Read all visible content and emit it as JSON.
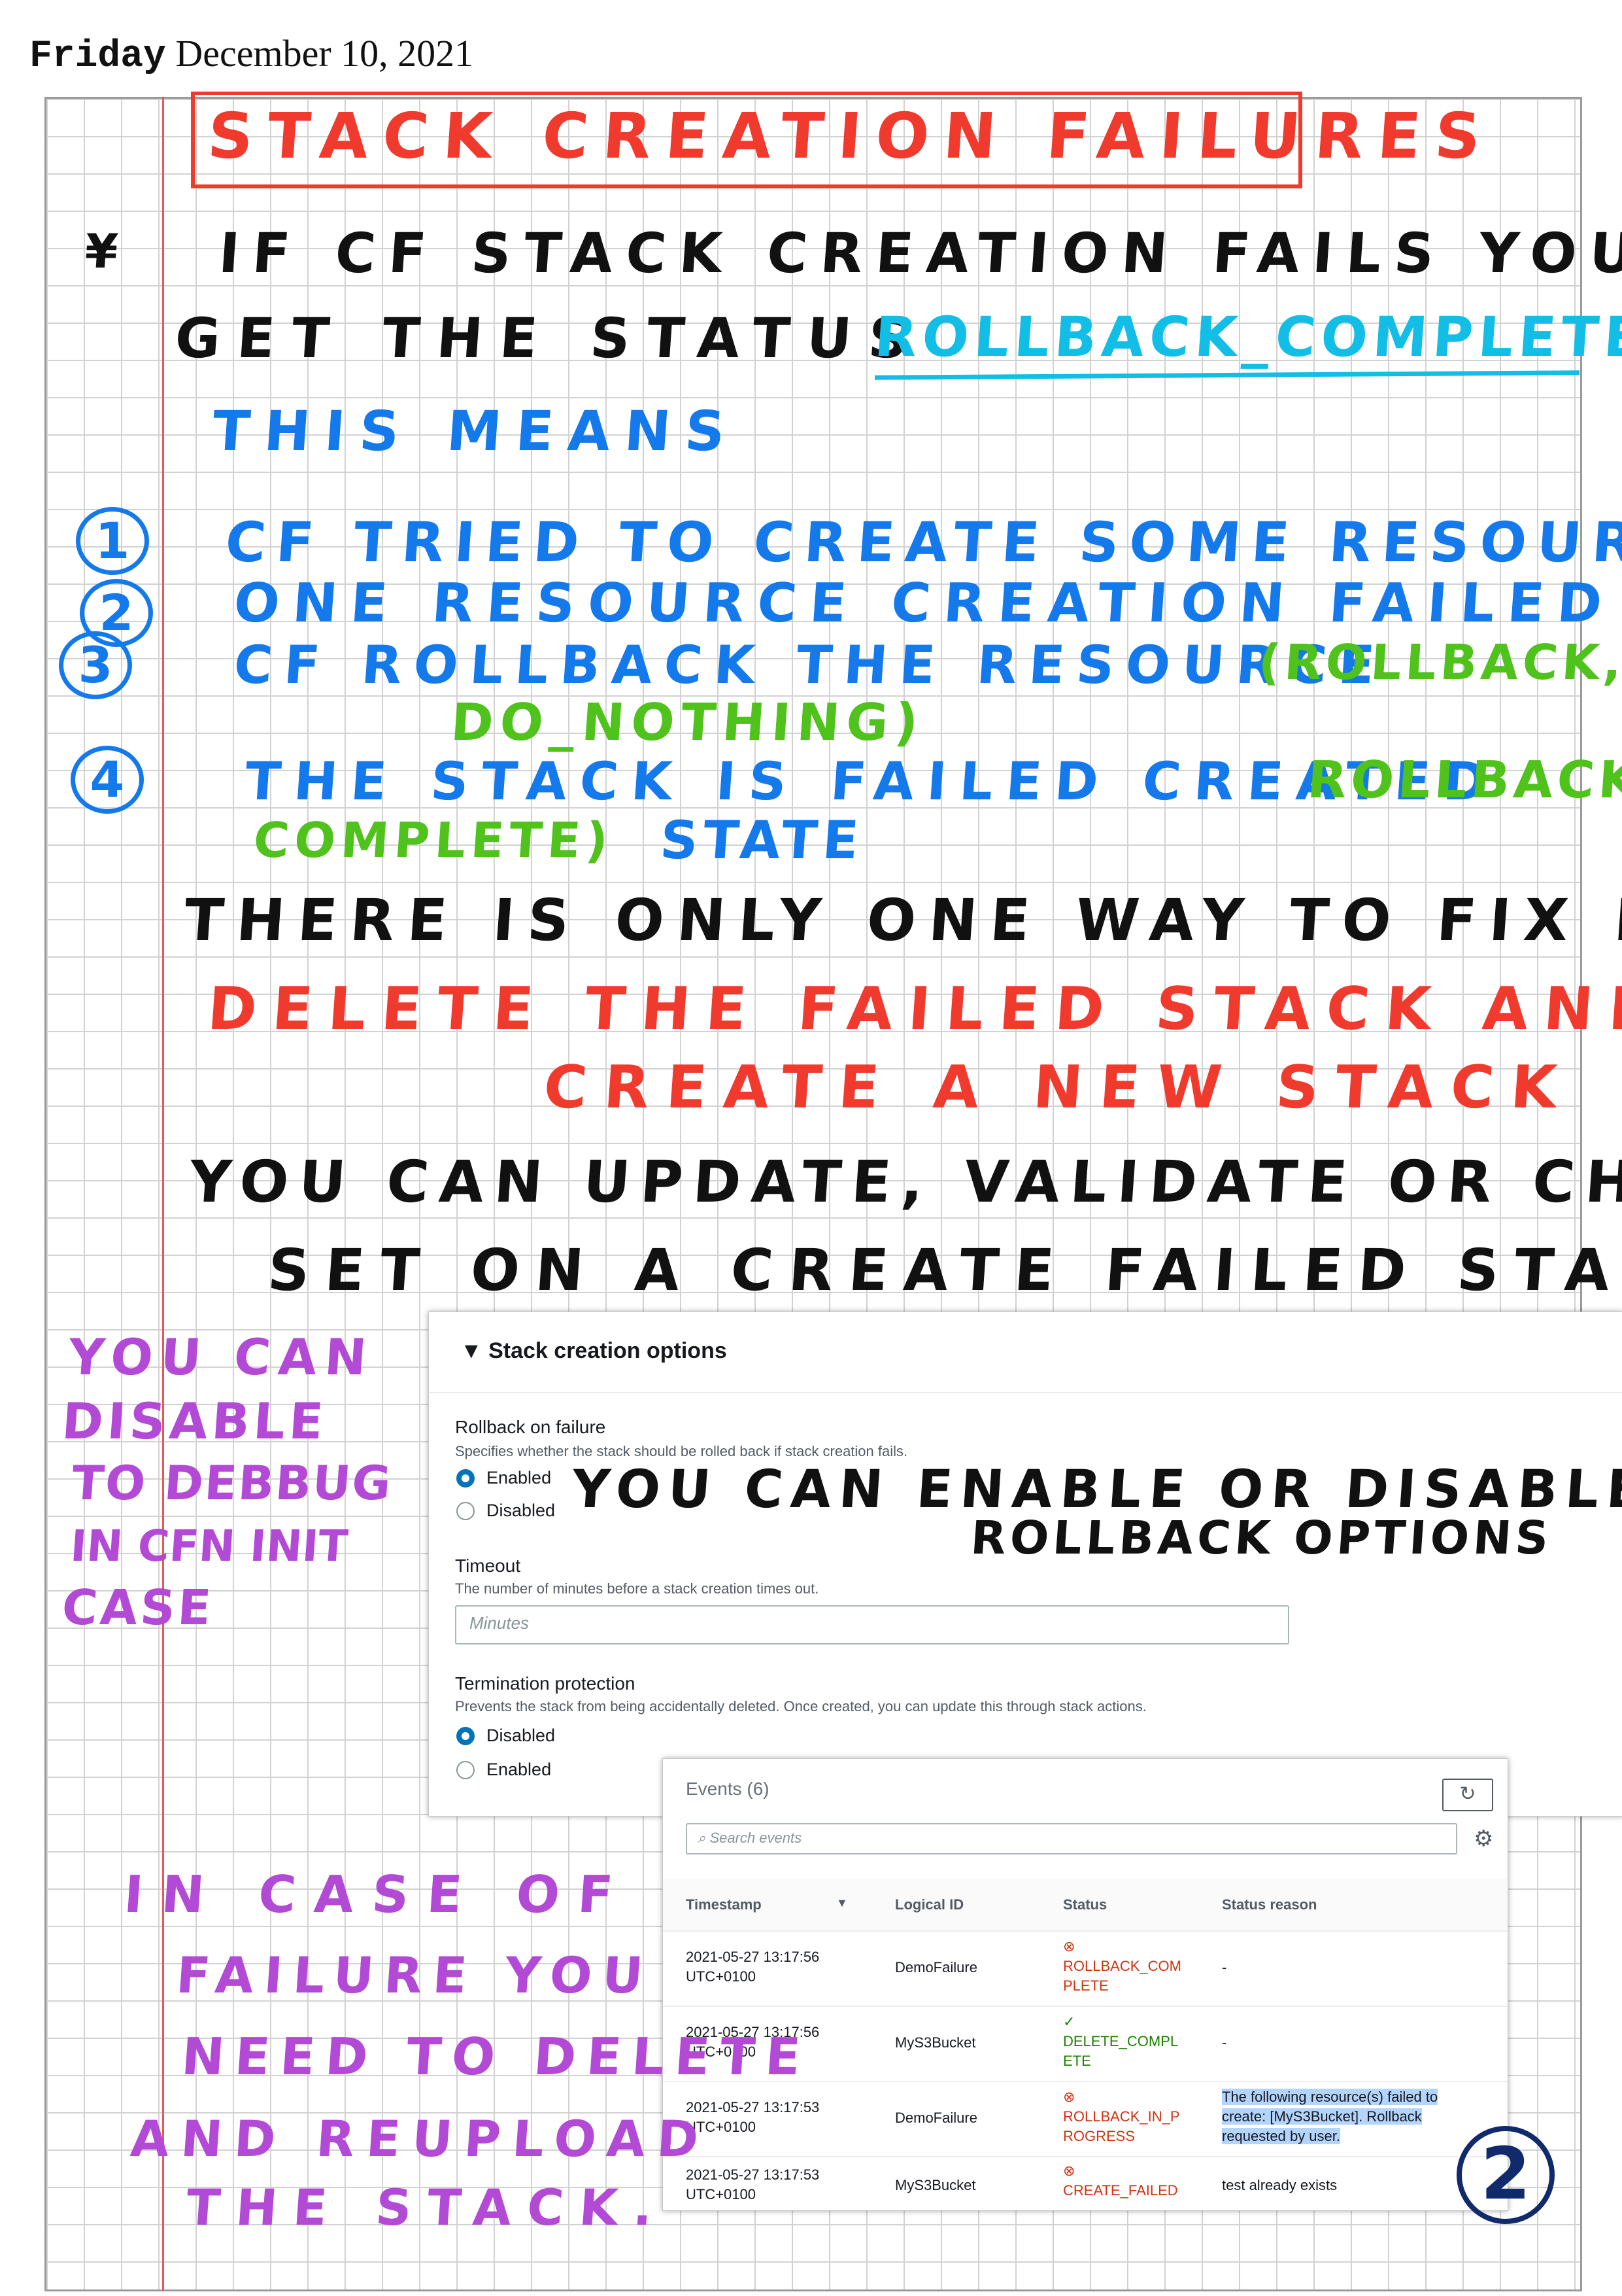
{
  "date": {
    "day": "Friday",
    "rest": "December 10, 2021"
  },
  "notes": {
    "title": "STACK CREATION FAILURES",
    "line1": "IF CF STACK CREATION FAILS YOU WILL",
    "line2a": "GET THE STATUS",
    "line2b": "ROLLBACK_COMPLETE",
    "line3": "THIS MEANS",
    "n1": "1",
    "n2": "2",
    "n3": "3",
    "n4": "4",
    "item1": "CF TRIED TO CREATE SOME RESOURCE",
    "item2": "ONE RESOURCE CREATION FAILED",
    "item3a": "CF ROLLBACK THE RESOURCE",
    "item3b": "(ROLLBACK,",
    "item3c": "DO_NOTHING)",
    "item4a": "THE STACK IS FAILED CREATED",
    "item4b": "ROLLBACK",
    "item4c": "COMPLETE)",
    "item4d": "STATE",
    "fix": "THERE IS ONLY ONE WAY TO FIX IT.",
    "red1": "DELETE THE FAILED STACK AND",
    "red2": "CREATE A NEW STACK",
    "you1": "YOU CAN UPDATE, VALIDATE OR CHANGE",
    "you2": "SET ON A CREATE FAILED STACK.",
    "side1": "YOU CAN",
    "side2": "DISABLE",
    "side3": "TO DEBBUG",
    "side4": "IN CFN INIT",
    "side5": "CASE",
    "enable1": "YOU CAN ENABLE OR DISABLE",
    "enable2": "ROLLBACK OPTIONS",
    "bottom1": "IN CASE OF",
    "bottom2": "FAILURE YOU",
    "bottom3": "NEED TO DELETE",
    "bottom4": "AND REUPLOAD",
    "bottom5": "THE STACK.",
    "page_num": "2"
  },
  "stack_options": {
    "header": "Stack creation options",
    "rollback_label": "Rollback on failure",
    "rollback_desc": "Specifies whether the stack should be rolled back if stack creation fails.",
    "rollback_enabled": "Enabled",
    "rollback_disabled": "Disabled",
    "timeout_label": "Timeout",
    "timeout_desc": "The number of minutes before a stack creation times out.",
    "timeout_placeholder": "Minutes",
    "term_label": "Termination protection",
    "term_desc": "Prevents the stack from being accidentally deleted. Once created, you can update this through stack actions.",
    "term_disabled": "Disabled",
    "term_enabled": "Enabled"
  },
  "events": {
    "title": "Events",
    "count": "(6)",
    "search_placeholder": "Search events",
    "columns": [
      "Timestamp",
      "Logical ID",
      "Status",
      "Status reason"
    ],
    "rows": [
      {
        "ts1": "2021-05-27 13:17:56",
        "ts2": "UTC+0100",
        "id": "DemoFailure",
        "s1": "ROLLBACK_COM",
        "s2": "PLETE",
        "reason": "-"
      },
      {
        "ts1": "2021-05-27 13:17:56",
        "ts2": "UTC+0100",
        "id": "MyS3Bucket",
        "s1": "DELETE_COMPL",
        "s2": "ETE",
        "reason": "-"
      },
      {
        "ts1": "2021-05-27 13:17:53",
        "ts2": "UTC+0100",
        "id": "DemoFailure",
        "s1": "ROLLBACK_IN_P",
        "s2": "ROGRESS",
        "r1": "The following resource(s) failed to",
        "r2": "create: [MyS3Bucket]. Rollback",
        "r3": "requested by user."
      },
      {
        "ts1": "2021-05-27 13:17:53",
        "ts2": "UTC+0100",
        "id": "MyS3Bucket",
        "s1": "CREATE_FAILED",
        "reason": "test already exists"
      }
    ]
  },
  "colors": {
    "red": "#f03a2e",
    "blue": "#1479ea",
    "cyan": "#12bde6",
    "green": "#4fc21b",
    "purple": "#b34ad6",
    "aws_blue": "#0073bb"
  }
}
